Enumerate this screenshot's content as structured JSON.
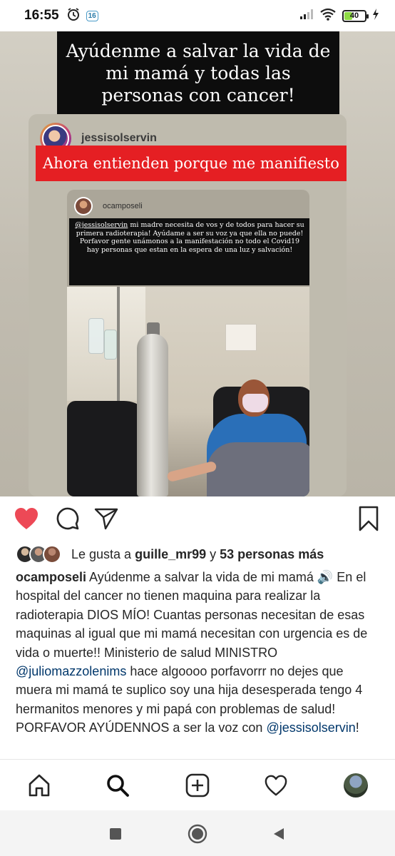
{
  "status_bar": {
    "time": "16:55",
    "notification_badge": "16",
    "battery_level": "40",
    "battery_fraction": 0.4
  },
  "story": {
    "headline": "Ayúdenme a salvar la vida de mi mamá y todas las personas con cancer!",
    "inner_username": "jessisolservin",
    "banner_text": "Ahora entienden porque me manifiesto",
    "nested_username": "ocamposeli",
    "nested_mention": "@jessisolservin",
    "nested_text": " mi madre necesita de vos y de todos para hacer su primera radioterapia! Ayúdame a ser su voz ya que ella no puede! Porfavor gente unámonos a la manifestación no todo el Covid19 hay personas que estan en la espera de una luz y salvación!"
  },
  "actions": {
    "like": "heart-filled-icon",
    "comment": "comment-icon",
    "share": "send-icon",
    "save": "bookmark-icon",
    "like_color": "#ed4956"
  },
  "likes": {
    "prefix": "Le gusta a ",
    "user": "guille_mr99",
    "middle": " y ",
    "others": "53 personas más"
  },
  "caption": {
    "username": "ocamposeli",
    "part1": " Ayúdenme a salvar la vida de mi mamá ",
    "emoji": "🔊",
    "part2": " En el hospital del cancer no tienen maquina para realizar la radioterapia DIOS MÍO!  Cuantas personas necesitan de esas maquinas al igual que mi mamá necesitan con urgencia es de vida o muerte!! Ministerio de salud MINISTRO ",
    "mention1": "@juliomazzolenims",
    "part3": " hace algoooo porfavorrr no dejes que muera mi mamá te suplico soy una hija desesperada tengo 4 hermanitos menores y mi papá con problemas de salud! PORFAVOR AYÚDENNOS a ser la voz con ",
    "mention2": "@jessisolservin",
    "part4": "!",
    "mention_color": "#00376b"
  },
  "bottom_nav": {
    "items": [
      "home-icon",
      "search-icon",
      "new-post-icon",
      "activity-icon",
      "profile-avatar"
    ]
  },
  "system_nav": {
    "items": [
      "recents-icon",
      "home-icon",
      "back-icon"
    ]
  }
}
